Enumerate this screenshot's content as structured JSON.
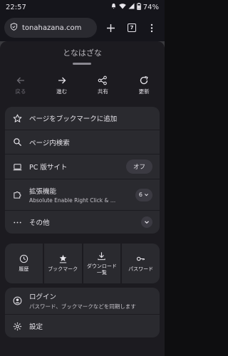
{
  "status": {
    "time": "22:57",
    "battery": "74%"
  },
  "toolbar": {
    "url": "tonahazana.com",
    "tab_count": "7"
  },
  "menu": {
    "page_title": "となはざな",
    "nav": [
      {
        "label": "戻る",
        "icon": "arrow-left-icon"
      },
      {
        "label": "進む",
        "icon": "arrow-right-icon"
      },
      {
        "label": "共有",
        "icon": "share-icon"
      },
      {
        "label": "更新",
        "icon": "reload-icon"
      }
    ],
    "add_bookmark": "ページをブックマークに追加",
    "find_in_page": "ページ内検索",
    "desktop_site": {
      "label": "PC 版サイト",
      "state": "オフ"
    },
    "extensions": {
      "label": "拡張機能",
      "sub": "Absolute Enable Right Click & …",
      "count": "6"
    },
    "more": "その他",
    "quick": [
      {
        "label": "履歴",
        "icon": "clock-icon"
      },
      {
        "label": "ブックマーク",
        "icon": "bookmark-star-icon"
      },
      {
        "label": "ダウンロード\n一覧",
        "icon": "download-icon"
      },
      {
        "label": "パスワード",
        "icon": "key-icon"
      }
    ],
    "login": {
      "label": "ログイン",
      "sub": "パスワード、ブックマークなどを同期します"
    },
    "settings": "設定"
  }
}
